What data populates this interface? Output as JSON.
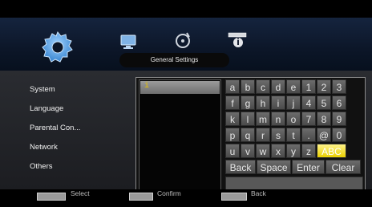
{
  "header": {
    "title": "General Settings",
    "tabs": [
      {
        "icon": "gear-icon"
      },
      {
        "icon": "monitor-icon"
      },
      {
        "icon": "audio-disc-icon"
      },
      {
        "icon": "info-icon"
      }
    ]
  },
  "menu": {
    "items": [
      "System",
      "Language",
      "Parental Con...",
      "Network",
      "Others"
    ]
  },
  "input": {
    "value": "",
    "cursor": "i"
  },
  "keyboard": {
    "rows": [
      [
        "a",
        "b",
        "c",
        "d",
        "e",
        "1",
        "2",
        "3"
      ],
      [
        "f",
        "g",
        "h",
        "i",
        "j",
        "4",
        "5",
        "6"
      ],
      [
        "k",
        "l",
        "m",
        "n",
        "o",
        "7",
        "8",
        "9"
      ],
      [
        "p",
        "q",
        "r",
        "s",
        "t",
        ".",
        "@",
        "0"
      ],
      [
        "u",
        "v",
        "w",
        "x",
        "y",
        "z",
        "ABC"
      ]
    ],
    "bottom": [
      "Back",
      "Space",
      "Enter",
      "Clear"
    ],
    "selected": "ABC"
  },
  "footer": {
    "hints": [
      {
        "label": "Select"
      },
      {
        "label": "Confirm"
      },
      {
        "label": "Back"
      }
    ]
  },
  "colors": {
    "accent": "#f3d400",
    "background": "#000000"
  }
}
